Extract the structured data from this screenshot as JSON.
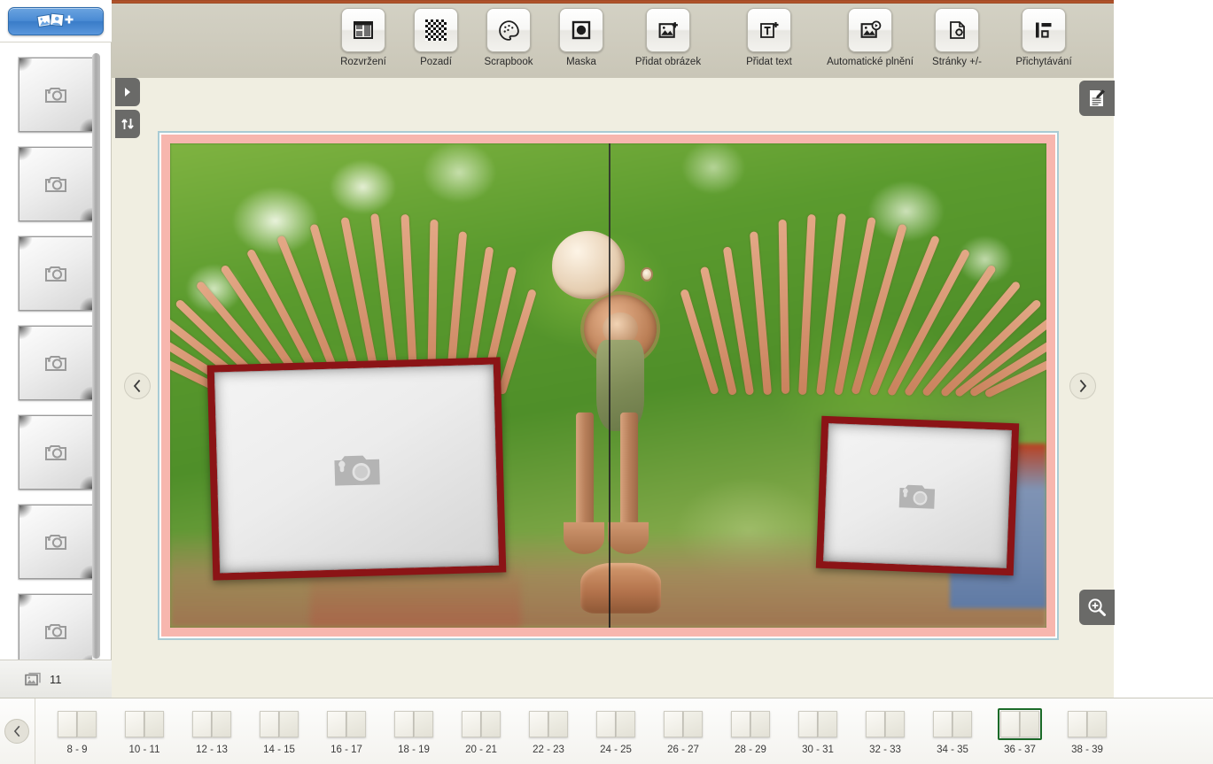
{
  "toolbar": {
    "items": [
      {
        "label": "Rozvržení",
        "icon": "layout-icon"
      },
      {
        "label": "Pozadí",
        "icon": "checkerboard-icon"
      },
      {
        "label": "Scrapbook",
        "icon": "palette-icon"
      },
      {
        "label": "Maska",
        "icon": "mask-icon"
      },
      {
        "label": "Přidat obrázek",
        "icon": "add-image-icon"
      },
      {
        "label": "Přidat text",
        "icon": "add-text-icon"
      },
      {
        "label": "Automatické plnění",
        "icon": "auto-fill-icon"
      },
      {
        "label": "Stránky +/-",
        "icon": "pages-settings-icon"
      },
      {
        "label": "Přichytávání",
        "icon": "snapping-icon"
      }
    ]
  },
  "photo_bin": {
    "add_button_icon": "add-photos-icon",
    "thumbnail_icon": "camera-icon",
    "thumbnail_count": 7,
    "count_icon": "photos-icon",
    "count_label": "11"
  },
  "side_tabs": [
    {
      "name": "expand-panel",
      "icon": "triangle-right-icon"
    },
    {
      "name": "sort-panel",
      "icon": "sort-updown-icon"
    }
  ],
  "canvas": {
    "prev_icon": "chevron-left-icon",
    "next_icon": "chevron-right-icon",
    "notes_icon": "notes-edit-icon",
    "zoom_icon": "zoom-in-icon",
    "placeholders": [
      {
        "name": "photo-placeholder-left",
        "icon": "camera-icon"
      },
      {
        "name": "photo-placeholder-right",
        "icon": "camera-icon"
      }
    ],
    "colors": {
      "selection_border": "#a9cbd4",
      "bleed": "#f7b6ae",
      "frame_border": "#8b1416",
      "canvas_bg": "#f0eee1"
    }
  },
  "page_strip": {
    "prev_icon": "chevron-left-icon",
    "selected": "36 - 37",
    "selection_color": "#1b6b28",
    "pages": [
      "8 - 9",
      "10 - 11",
      "12 - 13",
      "14 - 15",
      "16 - 17",
      "18 - 19",
      "20 - 21",
      "22 - 23",
      "24 - 25",
      "26 - 27",
      "28 - 29",
      "30 - 31",
      "32 - 33",
      "34 - 35",
      "36 - 37",
      "38 - 39"
    ]
  }
}
